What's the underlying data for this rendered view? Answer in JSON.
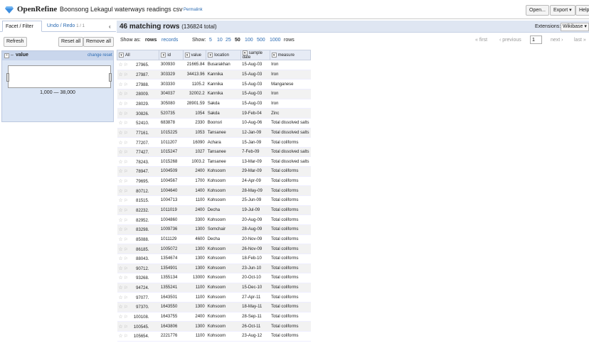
{
  "app": {
    "logo": "OpenRefine",
    "project": "Boonsong Lekagul waterways readings csv",
    "permalink": "Permalink"
  },
  "header_buttons": {
    "open": "Open...",
    "export": "Export ▾",
    "help": "Help"
  },
  "left": {
    "tab_facet": "Facet / Filter",
    "tab_undo": "Undo / Redo",
    "tab_undo_count": "1 / 1",
    "collapse": "‹",
    "refresh": "Refresh",
    "reset_all": "Reset all",
    "remove_all": "Remove all",
    "facet": {
      "close": "x",
      "minimize": "–",
      "name": "value",
      "change": "change",
      "reset": "reset",
      "range": "1,000 — 38,000"
    }
  },
  "main": {
    "count": "46 matching rows",
    "total": "(136824 total)",
    "extensions_label": "Extensions:",
    "extensions_value": "Wikibase ▾",
    "show_as_label": "Show as:",
    "show_rows": "rows",
    "show_records": "records",
    "show_label": "Show:",
    "page_sizes": [
      "5",
      "10",
      "25",
      "50",
      "100",
      "500",
      "1000"
    ],
    "rows_label": "rows",
    "first": "« first",
    "previous": "‹ previous",
    "page": "1",
    "next": "next ›",
    "last": "last »"
  },
  "table": {
    "columns": [
      "All",
      "id",
      "value",
      "location",
      "sample date",
      "measure"
    ],
    "rows": [
      [
        "27965.",
        "300930",
        "21665.84",
        "Busarakhan",
        "15-Aug-03",
        "Iron"
      ],
      [
        "27987.",
        "303329",
        "34413.96",
        "Kannika",
        "15-Aug-03",
        "Iron"
      ],
      [
        "27988.",
        "303330",
        "1105.2",
        "Kannika",
        "15-Aug-03",
        "Manganese"
      ],
      [
        "28009.",
        "304037",
        "32002.2",
        "Kannika",
        "15-Aug-03",
        "Iron"
      ],
      [
        "28029.",
        "305080",
        "28901.59",
        "Sakda",
        "15-Aug-03",
        "Iron"
      ],
      [
        "30826.",
        "520735",
        "1054",
        "Sakda",
        "19-Feb-04",
        "Zinc"
      ],
      [
        "52410.",
        "683878",
        "2330",
        "Boonsri",
        "10-Aug-06",
        "Total dissolved salts"
      ],
      [
        "77161.",
        "1015225",
        "1053",
        "Tansanee",
        "12-Jan-09",
        "Total dissolved salts"
      ],
      [
        "77207.",
        "1011207",
        "16090",
        "Achara",
        "15-Jan-09",
        "Total coliforms"
      ],
      [
        "77427.",
        "1015247",
        "1027",
        "Tansanee",
        "7-Feb-09",
        "Total dissolved salts"
      ],
      [
        "78243.",
        "1015268",
        "1003.2",
        "Tansanee",
        "13-Mar-09",
        "Total dissolved salts"
      ],
      [
        "78947.",
        "1004509",
        "2400",
        "Kohsoom",
        "29-Mar-09",
        "Total coliforms"
      ],
      [
        "79695.",
        "1004567",
        "1700",
        "Kohsoom",
        "24-Apr-09",
        "Total coliforms"
      ],
      [
        "80712.",
        "1004640",
        "1400",
        "Kohsoom",
        "28-May-09",
        "Total coliforms"
      ],
      [
        "81515.",
        "1004713",
        "1100",
        "Kohsoom",
        "25-Jun-09",
        "Total coliforms"
      ],
      [
        "82232.",
        "1011019",
        "2400",
        "Decha",
        "19-Jul-09",
        "Total coliforms"
      ],
      [
        "82952.",
        "1004860",
        "3300",
        "Kohsoom",
        "20-Aug-09",
        "Total coliforms"
      ],
      [
        "83298.",
        "1009736",
        "1300",
        "Somchair",
        "28-Aug-09",
        "Total coliforms"
      ],
      [
        "85088.",
        "1011129",
        "4600",
        "Decha",
        "20-Nov-09",
        "Total coliforms"
      ],
      [
        "86185.",
        "1005072",
        "1300",
        "Kohsoom",
        "26-Nov-09",
        "Total coliforms"
      ],
      [
        "88043.",
        "1354674",
        "1300",
        "Kohsoom",
        "18-Feb-10",
        "Total coliforms"
      ],
      [
        "90712.",
        "1354901",
        "1300",
        "Kohsoom",
        "23-Jun-10",
        "Total coliforms"
      ],
      [
        "93268.",
        "1355134",
        "13000",
        "Kohsoom",
        "20-Oct-10",
        "Total coliforms"
      ],
      [
        "94724.",
        "1355241",
        "1100",
        "Kohsoom",
        "15-Dec-10",
        "Total coliforms"
      ],
      [
        "97077.",
        "1643501",
        "1100",
        "Kohsoom",
        "27-Apr-11",
        "Total coliforms"
      ],
      [
        "97370.",
        "1643550",
        "1300",
        "Kohsoom",
        "18-May-11",
        "Total coliforms"
      ],
      [
        "100108.",
        "1643755",
        "2400",
        "Kohsoom",
        "28-Sep-11",
        "Total coliforms"
      ],
      [
        "100545.",
        "1643806",
        "1300",
        "Kohsoom",
        "26-Oct-11",
        "Total coliforms"
      ],
      [
        "105654.",
        "2221776",
        "1100",
        "Kohsoom",
        "23-Aug-12",
        "Total coliforms"
      ]
    ]
  }
}
